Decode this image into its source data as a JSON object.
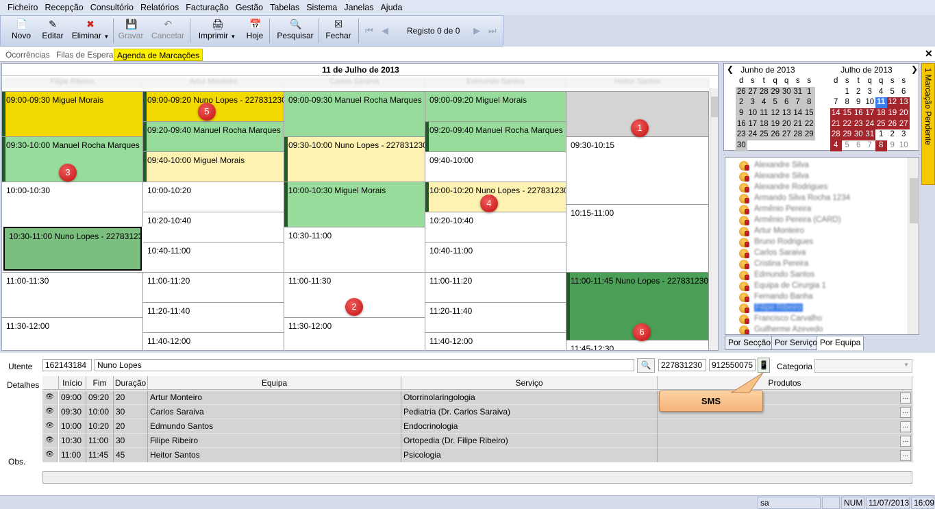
{
  "menu": [
    "Ficheiro",
    "Recepção",
    "Consultório",
    "Relatórios",
    "Facturação",
    "Gestão",
    "Tabelas",
    "Sistema",
    "Janelas",
    "Ajuda"
  ],
  "toolbar": {
    "novo": "Novo",
    "editar": "Editar",
    "eliminar": "Eliminar",
    "gravar": "Gravar",
    "cancelar": "Cancelar",
    "imprimir": "Imprimir",
    "hoje": "Hoje",
    "pesquisar": "Pesquisar",
    "fechar": "Fechar",
    "registo": "Registo 0 de 0"
  },
  "tabs": [
    "Ocorrências",
    "Filas de Espera",
    "Agenda de Marcações"
  ],
  "schedule": {
    "date": "11 de Julho de 2013",
    "columns": [
      "Filipe Ribeiro",
      "Artur Monteiro",
      "Carlos Saraiva",
      "Edmundo Santos",
      "Heitor Santos"
    ],
    "col1": [
      "09:00-09:30 Miguel Morais",
      "09:30-10:00 Manuel Rocha Marques",
      "10:00-10:30",
      "10:30-11:00 Nuno Lopes - 227831230",
      "11:00-11:30",
      "11:30-12:00"
    ],
    "col2": [
      "09:00-09:20 Nuno Lopes - 227831230",
      "09:20-09:40 Manuel Rocha Marques",
      "09:40-10:00 Miguel Morais",
      "10:00-10:20",
      "10:20-10:40",
      "10:40-11:00",
      "11:00-11:20",
      "11:20-11:40",
      "11:40-12:00"
    ],
    "col3": [
      "09:00-09:30 Manuel Rocha Marques",
      "09:30-10:00 Nuno Lopes - 227831230",
      "10:00-10:30 Miguel Morais",
      "10:30-11:00",
      "11:00-11:30",
      "11:30-12:00"
    ],
    "col4": [
      "09:00-09:20 Miguel Morais",
      "09:20-09:40 Manuel Rocha Marques",
      "09:40-10:00",
      "10:00-10:20 Nuno Lopes - 227831230",
      "10:20-10:40",
      "10:40-11:00",
      "11:00-11:20",
      "11:20-11:40",
      "11:40-12:00"
    ],
    "col5": [
      "",
      "09:30-10:15",
      "10:15-11:00",
      "11:00-11:45 Nuno Lopes - 227831230",
      "11:45-12:30"
    ],
    "badges": [
      "1",
      "2",
      "3",
      "4",
      "5",
      "6"
    ]
  },
  "calendar": {
    "m1": "Junho de 2013",
    "m2": "Julho de 2013",
    "dow": [
      "d",
      "s",
      "t",
      "q",
      "q",
      "s",
      "s"
    ],
    "june": [
      "26",
      "27",
      "28",
      "29",
      "30",
      "31",
      "1",
      "2",
      "3",
      "4",
      "5",
      "6",
      "7",
      "8",
      "9",
      "10",
      "11",
      "12",
      "13",
      "14",
      "15",
      "16",
      "17",
      "18",
      "19",
      "20",
      "21",
      "22",
      "23",
      "24",
      "25",
      "26",
      "27",
      "28",
      "29",
      "30"
    ],
    "july": [
      "",
      "1",
      "2",
      "3",
      "4",
      "5",
      "6",
      "7",
      "8",
      "9",
      "10",
      "11",
      "12",
      "13",
      "14",
      "15",
      "16",
      "17",
      "18",
      "19",
      "20",
      "21",
      "22",
      "23",
      "24",
      "25",
      "26",
      "27",
      "28",
      "29",
      "30",
      "31",
      "1",
      "2",
      "3",
      "4",
      "5",
      "6",
      "7",
      "8",
      "9",
      "10"
    ]
  },
  "pending": "1 Marcação Pendente",
  "tree": [
    "Alexandre Silva",
    "Alexandre Silva",
    "Alexandre Rodrigues",
    "Armando Silva Rocha 1234",
    "Armênio Pereira",
    "Armênio Pereira (CARD)",
    "Artur Monteiro",
    "Bruno Rodrigues",
    "Carlos Saraiva",
    "Cristina Pereira",
    "Edmundo Santos",
    "Equipa de Cirurgia 1",
    "Fernando Banha",
    "Filipe Ribeiro",
    "Francisco Carvalho",
    "Guilherme Azevedo"
  ],
  "viewtabs": [
    "Por Secção",
    "Por Serviço",
    "Por Equipa"
  ],
  "patient": {
    "utente_label": "Utente",
    "id": "162143184",
    "name": "Nuno Lopes",
    "phone1": "227831230",
    "phone2": "912550075",
    "categoria_label": "Categoria",
    "detalhes_label": "Detalhes",
    "obs_label": "Obs."
  },
  "sms": "SMS",
  "table": {
    "headers": [
      "Início",
      "Fim",
      "Duração",
      "Equipa",
      "Serviço",
      "Produtos"
    ],
    "rows": [
      [
        "09:00",
        "09:20",
        "20",
        "Artur Monteiro",
        "Otorrinolaringologia"
      ],
      [
        "09:30",
        "10:00",
        "30",
        "Carlos Saraiva",
        "Pediatria (Dr. Carlos Saraiva)"
      ],
      [
        "10:00",
        "10:20",
        "20",
        "Edmundo Santos",
        "Endocrinologia"
      ],
      [
        "10:30",
        "11:00",
        "30",
        "Filipe Ribeiro",
        "Ortopedia (Dr. Filipe Ribeiro)"
      ],
      [
        "11:00",
        "11:45",
        "45",
        "Heitor Santos",
        "Psicologia"
      ]
    ]
  },
  "status": {
    "user": "sa",
    "num": "NUM",
    "date": "11/07/2013",
    "time": "16:09"
  }
}
